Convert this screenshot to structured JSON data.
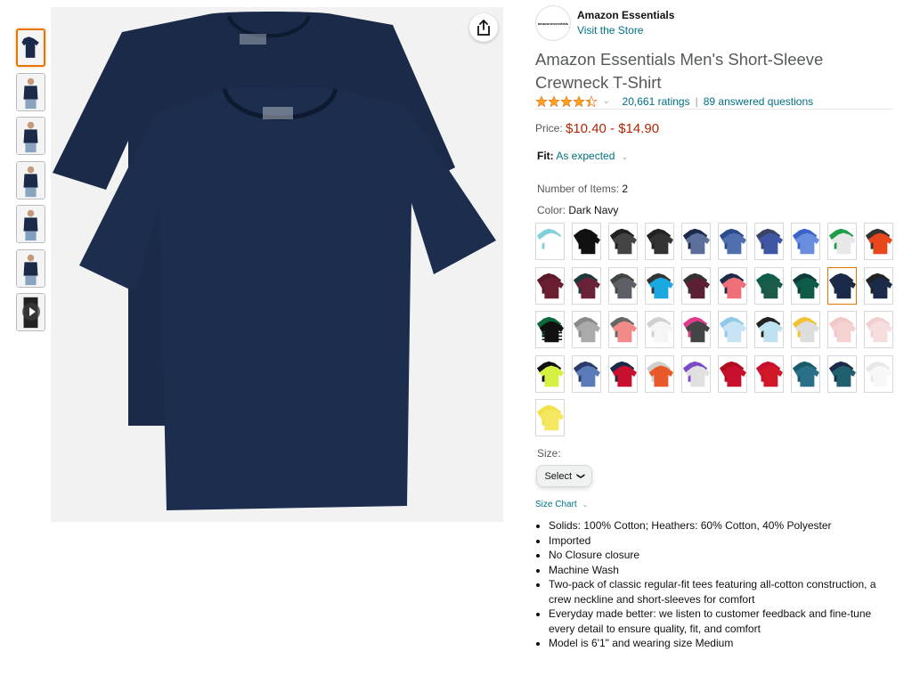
{
  "brand": {
    "logo_text": "amazonessentials",
    "name": "Amazon Essentials",
    "store_link": "Visit the Store"
  },
  "product": {
    "title": "Amazon Essentials Men's Short-Sleeve Crewneck T-Shirt",
    "rating_stars": 4.4,
    "ratings_count": "20,661 ratings",
    "answered_questions": "89 answered questions",
    "price_label": "Price:",
    "price": "$10.40 - $14.90",
    "fit_label": "Fit:",
    "fit_value": "As expected",
    "num_items_label": "Number of Items:",
    "num_items_value": "2",
    "color_label": "Color:",
    "color_value": "Dark Navy",
    "size_label": "Size:",
    "size_select": "Select",
    "size_chart": "Size Chart",
    "bullets": [
      "Solids: 100% Cotton; Heathers: 60% Cotton, 40% Polyester",
      "Imported",
      "No Closure closure",
      "Machine Wash",
      "Two-pack of classic regular-fit tees featuring all-cotton construction, a crew neckline and short-sleeves for comfort",
      "Everyday made better: we listen to customer feedback and fine-tune every detail to ensure quality, fit, and comfort",
      "Model is 6'1\" and wearing size Medium"
    ]
  },
  "colors": {
    "accent": "#e77600",
    "link": "#007185",
    "price": "#b12704",
    "star": "#ffa41c",
    "main_shirt": "#1a2a48"
  },
  "thumbnails": [
    {
      "color": "#1a2a48",
      "selected": true
    },
    {
      "color": "#1a2a48",
      "selected": false
    },
    {
      "color": "#1a2a48",
      "selected": false
    },
    {
      "color": "#1a2a48",
      "selected": false
    },
    {
      "color": "#1a2a48",
      "selected": false
    },
    {
      "color": "#1a2a48",
      "selected": false
    },
    {
      "color": "#1a2a48",
      "selected": false,
      "video": true
    }
  ],
  "swatches": [
    {
      "a": "#7fd0d8",
      "b": "#ffffff"
    },
    {
      "a": "#111111",
      "b": "#111111"
    },
    {
      "a": "#222222",
      "b": "#444444"
    },
    {
      "a": "#222222",
      "b": "#333333"
    },
    {
      "a": "#1a2a48",
      "b": "#5b6f9a"
    },
    {
      "a": "#2a4c8a",
      "b": "#4f6fae"
    },
    {
      "a": "#3a4466",
      "b": "#3f56a4"
    },
    {
      "a": "#3b63c8",
      "b": "#6a8de0"
    },
    {
      "a": "#1e9e4a",
      "b": "#e8e8e8"
    },
    {
      "a": "#333333",
      "b": "#e8471c"
    },
    {
      "a": "#5b1a2a",
      "b": "#6a1f30"
    },
    {
      "a": "#1d3a3a",
      "b": "#6a2238"
    },
    {
      "a": "#444444",
      "b": "#5c6066"
    },
    {
      "a": "#333333",
      "b": "#1ba7e0"
    },
    {
      "a": "#333333",
      "b": "#5b2035"
    },
    {
      "a": "#1a2a48",
      "b": "#f0707a"
    },
    {
      "a": "#0e5c4a",
      "b": "#1a5b4a"
    },
    {
      "a": "#0e3a3a",
      "b": "#0e5c48"
    },
    {
      "a": "#1a2a48",
      "b": "#1a2a48",
      "selected": true
    },
    {
      "a": "#222222",
      "b": "#1a2a48"
    },
    {
      "a": "#0c6a3a",
      "b": "#111111",
      "stripes": true
    },
    {
      "a": "#8a8a8a",
      "b": "#aaaaaa"
    },
    {
      "a": "#666666",
      "b": "#f28a8a"
    },
    {
      "a": "#d0d0d0",
      "b": "#f5f5f5"
    },
    {
      "a": "#e23a8a",
      "b": "#444444"
    },
    {
      "a": "#8fc8e8",
      "b": "#c8e4f4"
    },
    {
      "a": "#222222",
      "b": "#bfe2f0"
    },
    {
      "a": "#f2c230",
      "b": "#dddddd"
    },
    {
      "a": "#f0c8c8",
      "b": "#f4d2d2"
    },
    {
      "a": "#f2d0d0",
      "b": "#f6dede"
    },
    {
      "a": "#111111",
      "b": "#d8f042"
    },
    {
      "a": "#2a3a6a",
      "b": "#5a7ab8"
    },
    {
      "a": "#1a2a48",
      "b": "#c8102e"
    },
    {
      "a": "#cfcfcf",
      "b": "#e8592a"
    },
    {
      "a": "#7a4ac8",
      "b": "#e0e0e0"
    },
    {
      "a": "#b00e1e",
      "b": "#c8102e"
    },
    {
      "a": "#c8102e",
      "b": "#d01828"
    },
    {
      "a": "#1a5a6a",
      "b": "#2a7088"
    },
    {
      "a": "#1a2a48",
      "b": "#1f5f6e"
    },
    {
      "a": "#e8e8e8",
      "b": "#f8f8f8"
    },
    {
      "a": "#f2e24a",
      "b": "#f5e860"
    }
  ]
}
